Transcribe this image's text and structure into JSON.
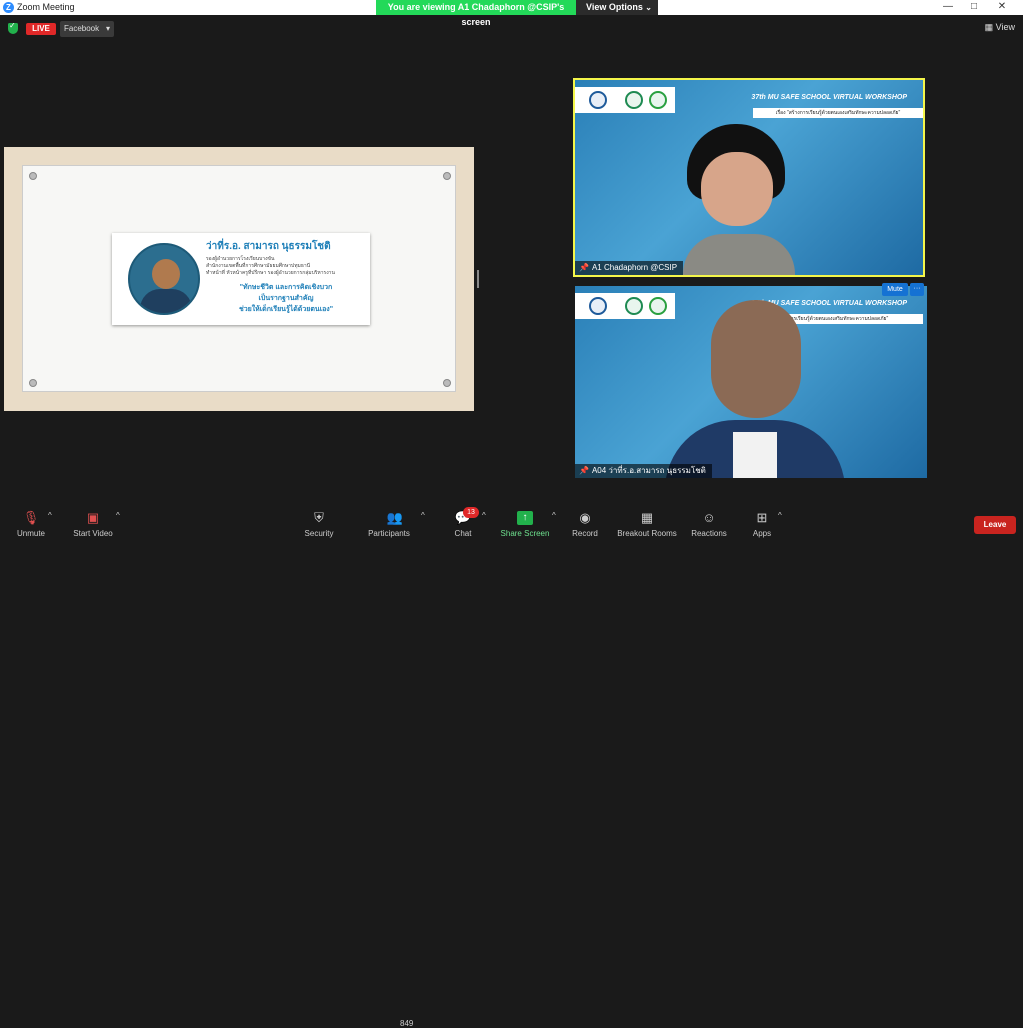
{
  "window": {
    "app_icon_letter": "Z",
    "title": "Zoom Meeting",
    "minimize": "—",
    "maximize": "□",
    "close": "✕"
  },
  "share_banner": {
    "text": "You are viewing A1 Chadaphorn @CSIP's screen",
    "view_options_label": "View Options",
    "chevron": "⌄"
  },
  "top_left": {
    "live_label": "LIVE",
    "stream_target": "Facebook",
    "dropdown_arrow": "▾"
  },
  "top_right": {
    "view_label": "View"
  },
  "shared_screen": {
    "speaker_name": "ว่าที่ร.อ. สามารถ นุธรรมโชติ",
    "role_lines": [
      "รองผู้อำนวยการโรงเรียนบางขัน",
      "สำนักงานเขตพื้นที่การศึกษามัธยมศึกษาปทุมธานี",
      "ทำหน้าที่",
      "หัวหน้าครูที่ปรึกษา รองผู้อำนวยการกลุ่มบริหารงาน"
    ],
    "quote_lines": [
      "\"ทักษะชีวิต และการคิดเชิงบวก",
      "เป็นรากฐานสำคัญ",
      "ช่วยให้เด็กเรียนรู้ได้ด้วยตนเอง\""
    ]
  },
  "video_tiles": [
    {
      "banner_title": "37th MU SAFE SCHOOL VIRTUAL WORKSHOP",
      "banner_subtitle": "เรื่อง \"สร้างการเรียนรู้ด้วยตนเองเสริมทักษะความปลอดภัย\"",
      "participant_name": "A1 Chadaphorn @CSIP",
      "active_speaker": true
    },
    {
      "banner_title": "37th MU SAFE SCHOOL VIRTUAL WORKSHOP",
      "banner_subtitle": "การเรียนรู้ด้วยตนเองเสริมทักษะความปลอดภัย\"",
      "participant_name": "A04 ว่าที่ร.อ.สามารถ นุธรรมโชติ",
      "mute_label": "Mute",
      "more_label": "···"
    }
  ],
  "toolbar": {
    "unmute": "Unmute",
    "start_video": "Start Video",
    "security": "Security",
    "participants": "Participants",
    "participants_count": "849",
    "chat": "Chat",
    "chat_badge": "13",
    "share_screen": "Share Screen",
    "record": "Record",
    "breakout_rooms": "Breakout Rooms",
    "reactions": "Reactions",
    "apps": "Apps",
    "leave": "Leave"
  },
  "icons": {
    "mic_muted": "mic-muted-icon",
    "video_off": "video-off-icon",
    "security": "shield-icon",
    "participants": "people-icon",
    "chat": "chat-icon",
    "share": "share-arrow-icon",
    "record": "record-icon",
    "breakout": "grid-icon",
    "reactions": "smile-icon",
    "apps": "apps-icon"
  },
  "colors": {
    "live": "#e02828",
    "share_banner": "#23d959",
    "active_speaker_border": "#f4f64a",
    "leave": "#c9241f",
    "share_button": "#22b14c",
    "mute_button": "#1572d3"
  }
}
